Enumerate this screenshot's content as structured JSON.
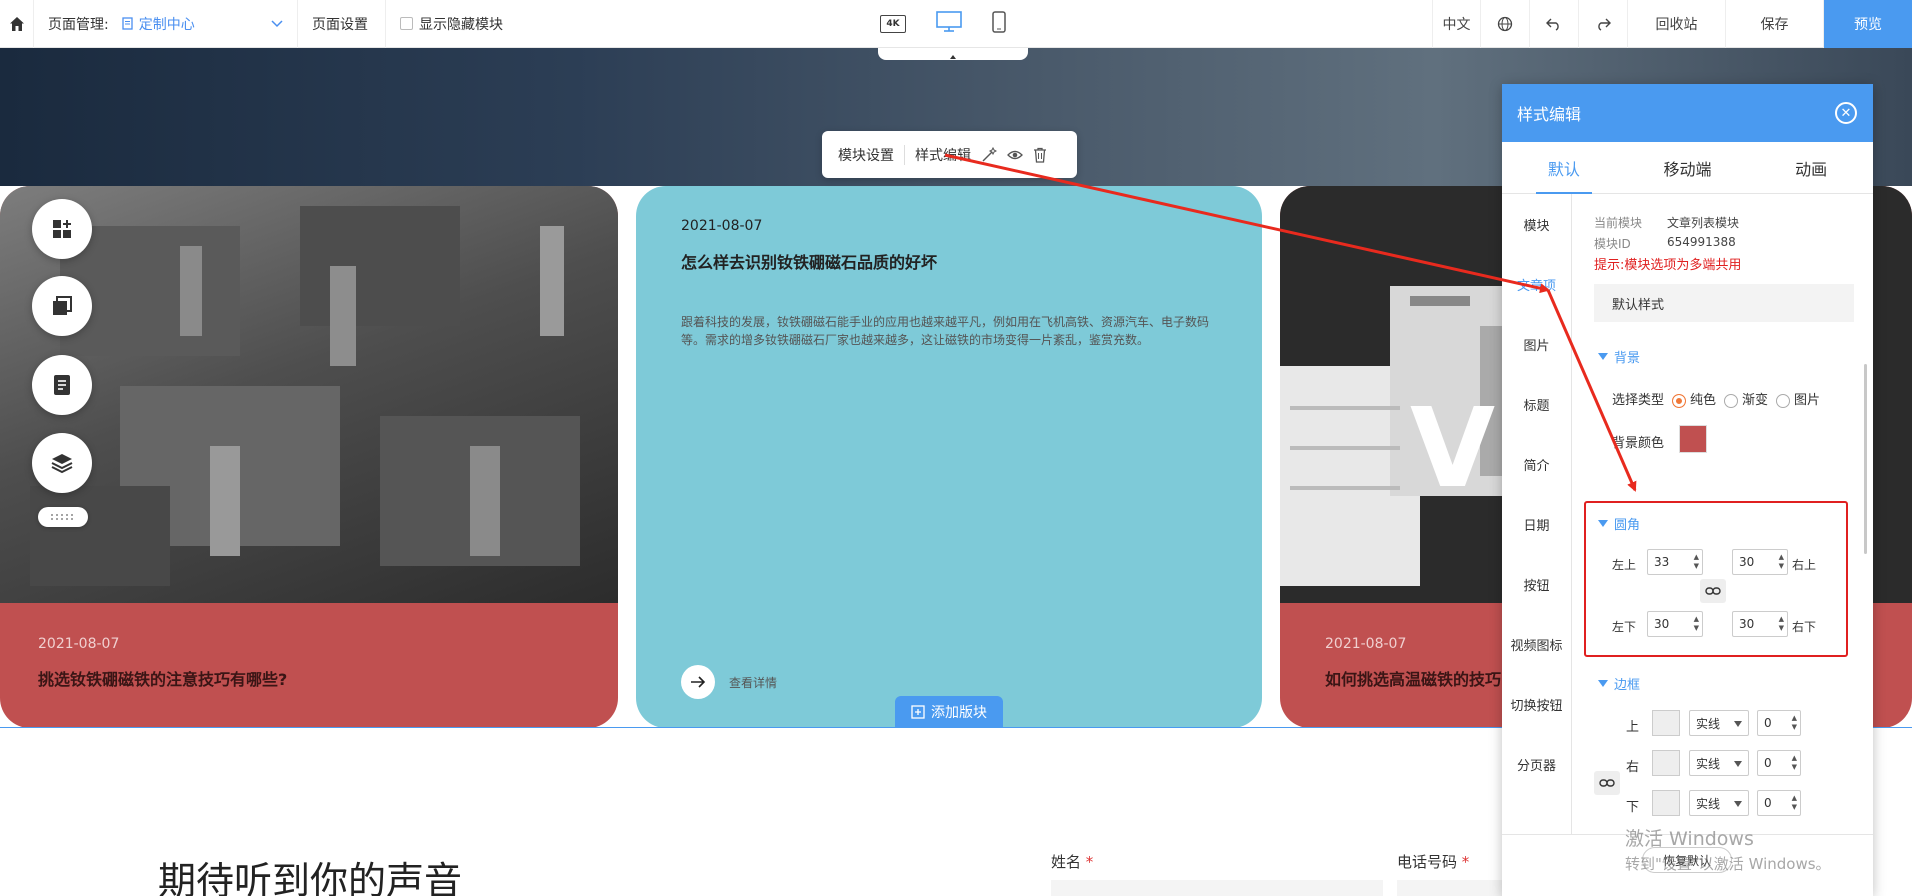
{
  "topbar": {
    "page_mgmt_label": "页面管理:",
    "page_selected": "定制中心",
    "page_settings": "页面设置",
    "show_hidden": "显示隐藏模块",
    "view_4k": "4K",
    "lang": "中文",
    "recycle": "回收站",
    "save": "保存",
    "preview": "预览"
  },
  "module_toolbar": {
    "settings": "模块设置",
    "style_edit": "样式编辑"
  },
  "cards": [
    {
      "date": "2021-08-07",
      "title": "挑选钕铁硼磁铁的注意技巧有哪些?"
    },
    {
      "date": "2021-08-07",
      "title": "怎么样去识别钕铁硼磁石品质的好坏",
      "desc": "跟着科技的发展，钕铁硼磁石能手业的应用也越来越平凡，例如用在飞机高铁、资源汽车、电子数码等。需求的增多钕铁硼磁石厂家也越来越多，这让磁铁的市场变得一片紊乱，鉴赏充数。",
      "more": "查看详情"
    },
    {
      "date": "2021-08-07",
      "title": "如何挑选高温磁铁的技巧"
    }
  ],
  "add_block": "添加版块",
  "contact": {
    "title": "期待听到你的声音",
    "name_label": "姓名",
    "phone_label": "电话号码",
    "required": "*"
  },
  "panel": {
    "title": "样式编辑",
    "tabs": [
      "默认",
      "移动端",
      "动画"
    ],
    "nav": [
      "模块",
      "文章项",
      "图片",
      "标题",
      "简介",
      "日期",
      "按钮",
      "视频图标",
      "切换按钮",
      "分页器"
    ],
    "current_module_label": "当前模块",
    "current_module": "文章列表模块",
    "module_id_label": "模块ID",
    "module_id": "654991388",
    "hint": "提示:模块选项为多端共用",
    "default_style": "默认样式",
    "bg_section": "背景",
    "select_type": "选择类型",
    "type_solid": "纯色",
    "type_gradient": "渐变",
    "type_image": "图片",
    "bg_color_label": "背景颜色",
    "bg_color": "#c05050",
    "radius_section": "圆角",
    "top_left_label": "左上",
    "top_left": "33",
    "top_right_label": "右上",
    "top_right": "30",
    "bottom_left_label": "左下",
    "bottom_left": "30",
    "bottom_right_label": "右下",
    "bottom_right": "30",
    "border_section": "边框",
    "border_rows": [
      {
        "side": "上",
        "style": "实线",
        "width": "0"
      },
      {
        "side": "右",
        "style": "实线",
        "width": "0"
      },
      {
        "side": "下",
        "style": "实线",
        "width": "0"
      }
    ],
    "restore": "恢复默认"
  },
  "watermark": {
    "line1": "激活 Windows",
    "line2": "转到\"设置\"以激活 Windows。"
  }
}
